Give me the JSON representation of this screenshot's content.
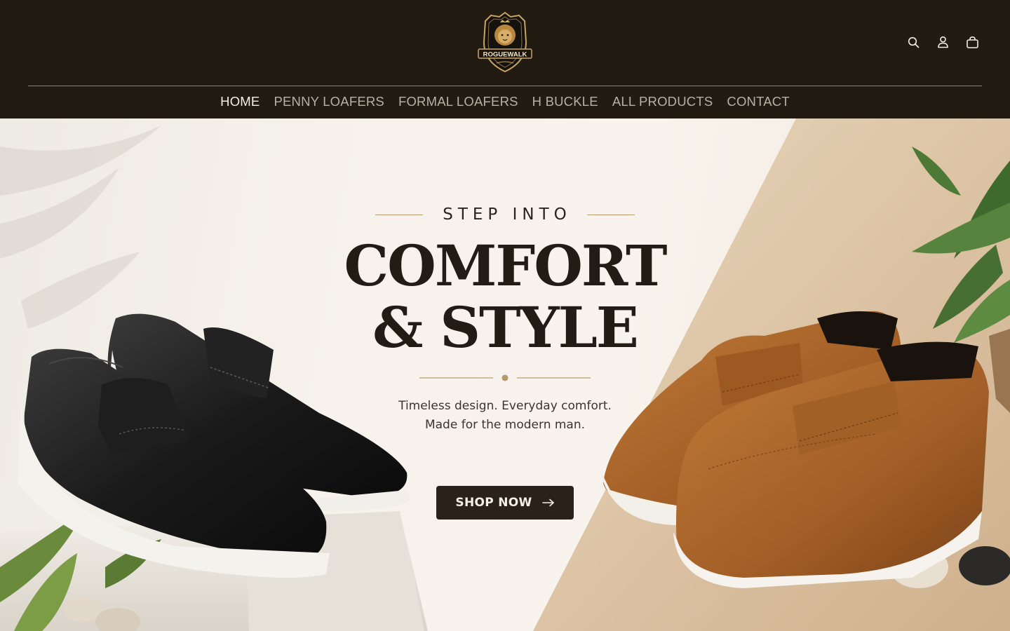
{
  "brand": {
    "name": "ROGUEWALK",
    "logo_icon": "lion-crest-icon"
  },
  "header_icons": [
    {
      "name": "search-icon"
    },
    {
      "name": "account-icon"
    },
    {
      "name": "cart-icon"
    }
  ],
  "nav": {
    "items": [
      {
        "label": "HOME",
        "active": true
      },
      {
        "label": "PENNY LOAFERS",
        "active": false
      },
      {
        "label": "FORMAL LOAFERS",
        "active": false
      },
      {
        "label": "H BUCKLE",
        "active": false
      },
      {
        "label": "ALL PRODUCTS",
        "active": false
      },
      {
        "label": "CONTACT",
        "active": false
      }
    ]
  },
  "hero": {
    "eyebrow": "STEP INTO",
    "headline_line1": "COMFORT",
    "headline_line2": "& STYLE",
    "subtext_line1": "Timeless design. Everyday comfort.",
    "subtext_line2": "Made for the modern man.",
    "cta_label": "SHOP NOW"
  },
  "colors": {
    "header_bg": "#221b12",
    "nav_active": "#f3ede2",
    "nav_inactive": "#b8b0a2",
    "accent_gold": "#b79a6e",
    "cta_bg": "#2a211b",
    "loafer_black": "#1b1b1b",
    "loafer_tan": "#a8622a"
  }
}
